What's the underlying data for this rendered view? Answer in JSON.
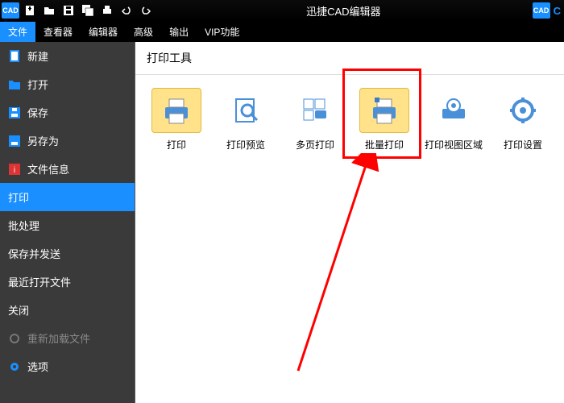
{
  "titlebar": {
    "app_icon_text": "CAD",
    "title": "迅捷CAD编辑器",
    "right_icon_text": "CAD",
    "right_letter": "C"
  },
  "menubar": {
    "items": [
      "文件",
      "查看器",
      "编辑器",
      "高级",
      "输出",
      "VIP功能"
    ],
    "active_index": 0
  },
  "sidebar": {
    "items": [
      {
        "label": "新建",
        "icon": "file-new-icon"
      },
      {
        "label": "打开",
        "icon": "folder-open-icon"
      },
      {
        "label": "保存",
        "icon": "save-icon"
      },
      {
        "label": "另存为",
        "icon": "save-as-icon"
      },
      {
        "label": "文件信息",
        "icon": "file-info-icon"
      },
      {
        "label": "打印",
        "icon": "print-icon",
        "active": true
      },
      {
        "label": "批处理",
        "icon": ""
      },
      {
        "label": "保存并发送",
        "icon": ""
      },
      {
        "label": "最近打开文件",
        "icon": ""
      },
      {
        "label": "关闭",
        "icon": ""
      },
      {
        "label": "重新加载文件",
        "icon": "reload-icon",
        "disabled": true
      },
      {
        "label": "选项",
        "icon": "gear-icon"
      }
    ]
  },
  "content": {
    "header": "打印工具",
    "tools": [
      {
        "label": "打印",
        "icon": "printer-icon",
        "selected": true
      },
      {
        "label": "打印预览",
        "icon": "print-preview-icon"
      },
      {
        "label": "多页打印",
        "icon": "multipage-print-icon"
      },
      {
        "label": "批量打印",
        "icon": "batch-print-icon",
        "selected": true,
        "highlight": true
      },
      {
        "label": "打印视图区域",
        "icon": "print-area-icon"
      },
      {
        "label": "打印设置",
        "icon": "print-settings-icon"
      }
    ]
  }
}
